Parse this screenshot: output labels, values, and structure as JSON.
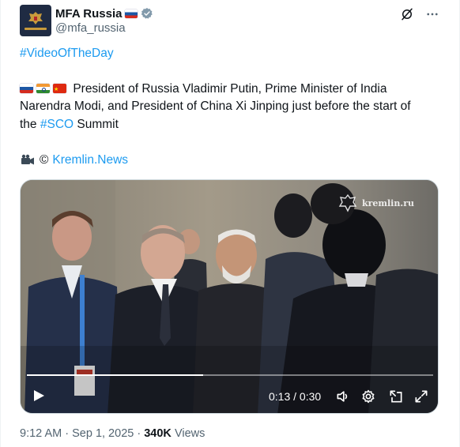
{
  "author": {
    "name": "MFA Russia",
    "handle": "@mfa_russia",
    "flag_icon": "russian-flag-icon",
    "verified_icon": "verified-badge-icon",
    "verified_color": "#829aab"
  },
  "header_icons": [
    "grok-icon",
    "more-icon"
  ],
  "post": {
    "hashtag_video": "#VideoOfTheDay",
    "flags": [
      "russian-flag-icon",
      "indian-flag-icon",
      "chinese-flag-icon"
    ],
    "text_line1": "President of Russia Vladimir Putin, Prime Minister of India",
    "text_line2": "Narendra Modi, and President of China Xi Jinping just before the start of",
    "text_line3_prefix": "the ",
    "hashtag_sco": "#SCO",
    "text_line3_suffix": " Summit",
    "credit_icon": "video-camera-icon",
    "credit_copyright": "©",
    "credit_link": "Kremlin.News",
    "link_color": "#1d9bf0"
  },
  "video": {
    "watermark": "kremlin.ru",
    "current_time": "0:13",
    "separator": "/",
    "duration": "0:30",
    "progress_fraction": 0.433,
    "control_icons": [
      "play-icon",
      "volume-icon",
      "settings-icon",
      "pip-icon",
      "fullscreen-icon"
    ]
  },
  "meta": {
    "time": "9:12 AM",
    "dot": "·",
    "date": "Sep 1, 2025",
    "views_count": "340K",
    "views_label": "Views"
  }
}
